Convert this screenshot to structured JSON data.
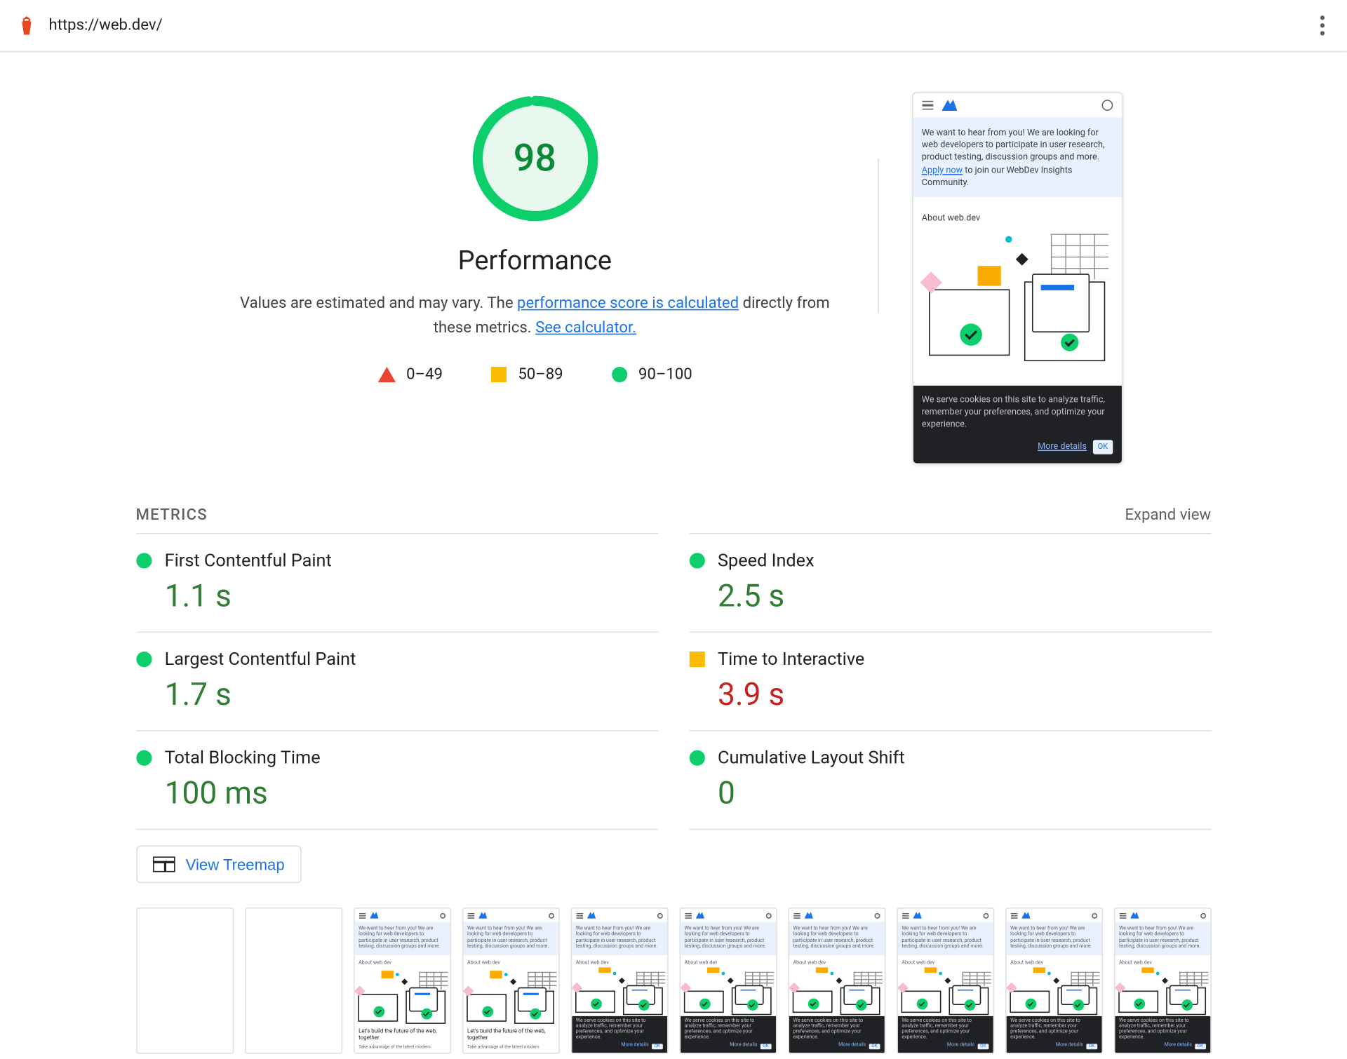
{
  "url": "https://web.dev/",
  "gauge": {
    "score": "98",
    "category": "Performance",
    "percent": 98
  },
  "disclaimer": {
    "prefix": "Values are estimated and may vary. The ",
    "link1": "performance score is calculated",
    "middle": " directly from these metrics. ",
    "link2": "See calculator."
  },
  "legend": {
    "fail": "0–49",
    "avg": "50–89",
    "pass": "90–100"
  },
  "thumbnail": {
    "banner_pre": "We want to hear from you! We are looking for web developers to participate in user research, product testing, discussion groups and more. ",
    "banner_link": "Apply now",
    "banner_post": " to join our WebDev Insights Community.",
    "about": "About web.dev",
    "cookie_text": "We serve cookies on this site to analyze traffic, remember your preferences, and optimize your experience.",
    "more_details": "More details",
    "ok": "OK"
  },
  "metrics_header": {
    "title": "METRICS",
    "expand": "Expand view"
  },
  "metrics": [
    {
      "name": "First Contentful Paint",
      "value": "1.1 s",
      "status": "green"
    },
    {
      "name": "Speed Index",
      "value": "2.5 s",
      "status": "green"
    },
    {
      "name": "Largest Contentful Paint",
      "value": "1.7 s",
      "status": "green"
    },
    {
      "name": "Time to Interactive",
      "value": "3.9 s",
      "status": "amber"
    },
    {
      "name": "Total Blocking Time",
      "value": "100 ms",
      "status": "green"
    },
    {
      "name": "Cumulative Layout Shift",
      "value": "0",
      "status": "green"
    }
  ],
  "treemap_label": "View Treemap",
  "filmstrip": {
    "banner_text": "We want to hear from you! We are looking for web developers to participate in user research, product testing, discussion groups and more.",
    "about": "About web.dev",
    "build_title": "Let's build the future of the web, together",
    "build_sub": "Take advantage of the latest modern",
    "cookie_text": "We serve cookies on this site to analyze traffic, remember your preferences, and optimize your experience.",
    "more_details": "More details",
    "ok": "OK",
    "frames": [
      {
        "type": "blank"
      },
      {
        "type": "blank"
      },
      {
        "type": "build"
      },
      {
        "type": "build"
      },
      {
        "type": "cookie"
      },
      {
        "type": "cookie"
      },
      {
        "type": "cookie"
      },
      {
        "type": "cookie"
      },
      {
        "type": "cookie"
      },
      {
        "type": "cookie"
      }
    ]
  }
}
